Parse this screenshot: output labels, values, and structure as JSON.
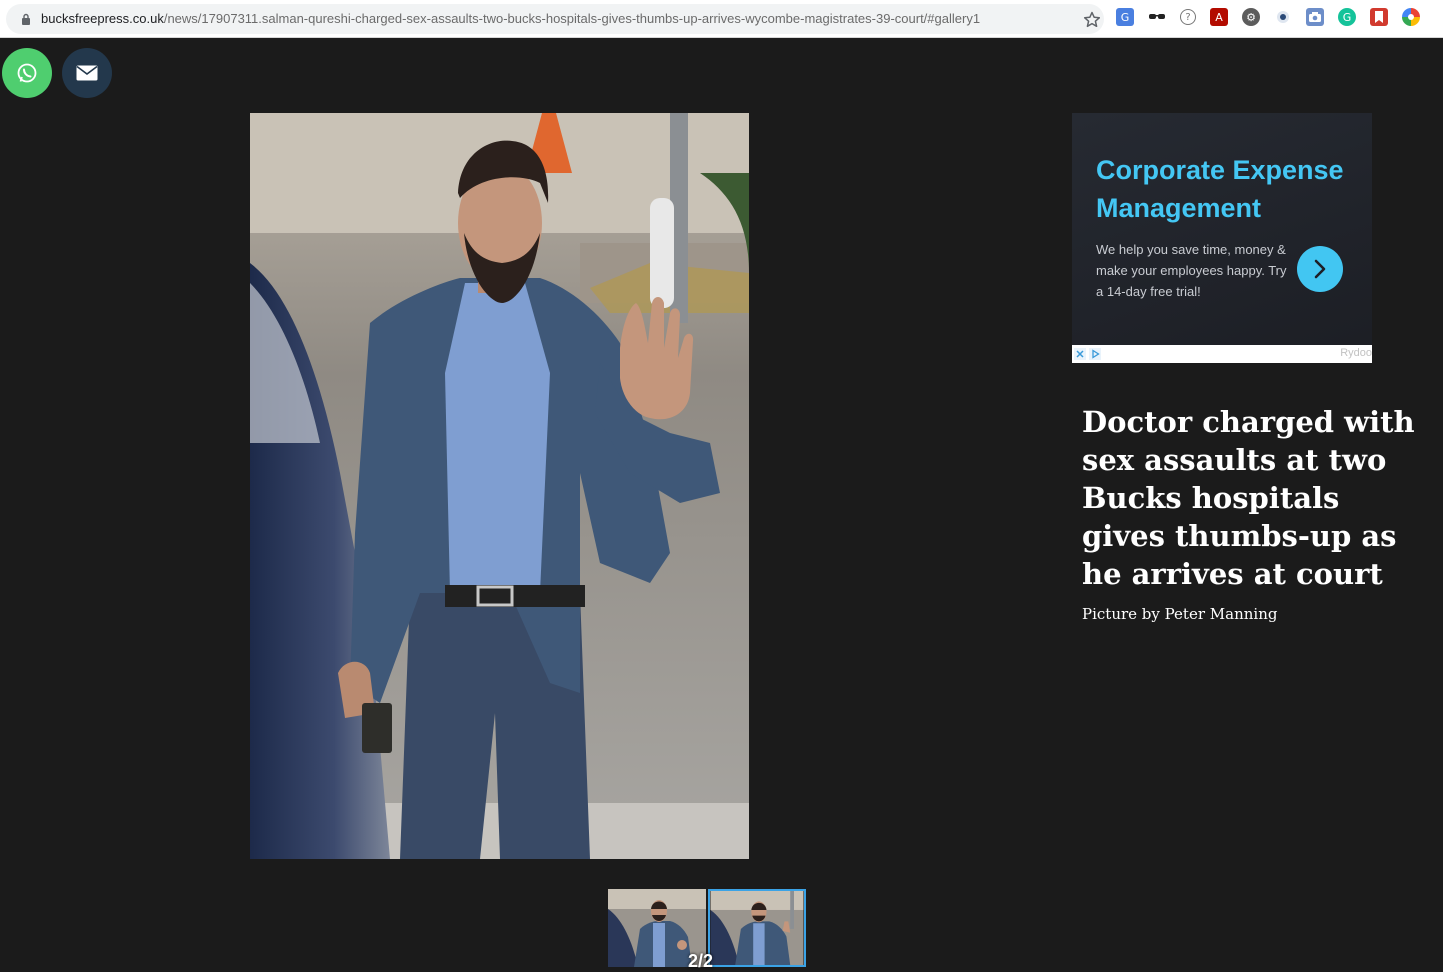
{
  "browser": {
    "url_domain": "bucksfreepress.co.uk",
    "url_path": "/news/17907311.salman-qureshi-charged-sex-assaults-two-bucks-hospitals-gives-thumbs-up-arrives-wycombe-magistrates-39-court/#gallery1",
    "icons": [
      "lock-icon",
      "star-icon",
      "translate-icon",
      "glasses-icon",
      "help-icon",
      "pdf-icon",
      "settings-icon",
      "record-icon",
      "camera-icon",
      "grammarly-icon",
      "bookmark-icon",
      "google-icon"
    ]
  },
  "share": {
    "buttons": [
      "whatsapp-icon",
      "email-icon"
    ]
  },
  "gallery": {
    "counter": "2/2",
    "active_thumbnail": 2
  },
  "ad": {
    "title": "Corporate Expense Management",
    "body": "We help you save time, money & make your employees happy. Try a 14-day free trial!",
    "brand": "Rydoo",
    "accent_color": "#44c7f4"
  },
  "caption": {
    "headline": "Doctor charged with sex assaults at two Bucks hospitals gives thumbs-up as he arrives at court",
    "credit": "Picture by Peter Manning"
  }
}
